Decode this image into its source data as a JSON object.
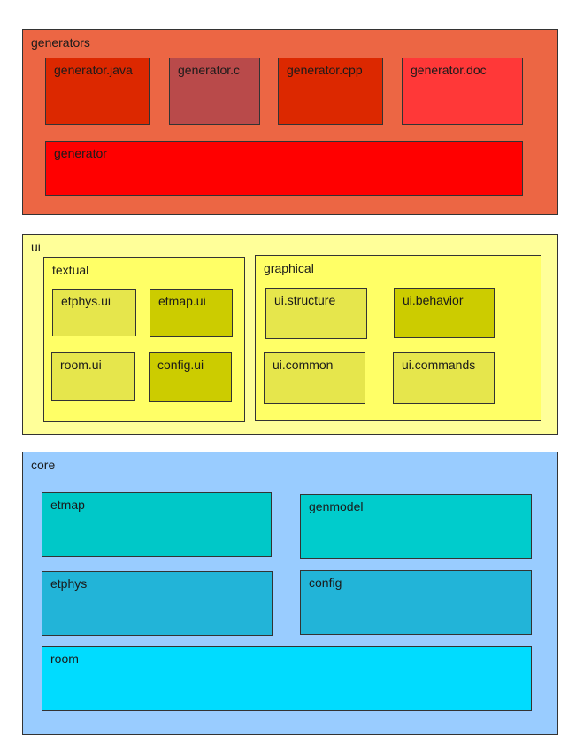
{
  "colors": {
    "generators": "#ec6644",
    "generator_java": "#dc2800",
    "generator_c": "#b94a4a",
    "generator_cpp": "#dc2800",
    "generator_doc": "#ff3838",
    "generator": "#ff0000",
    "ui": "#ffff99",
    "textual": "#ffff66",
    "graphical": "#ffff66",
    "ui_light": "#e6e64c",
    "ui_dark": "#cccc00",
    "core": "#99ccff",
    "etmap": "#00c8c8",
    "genmodel": "#00cccc",
    "etphys": "#22b4d8",
    "config": "#22b4d8",
    "room": "#00dcff",
    "border": "#333333"
  },
  "generators": {
    "label": "generators",
    "items": {
      "java": "generator.java",
      "c": "generator.c",
      "cpp": "generator.cpp",
      "doc": "generator.doc",
      "base": "generator"
    }
  },
  "ui": {
    "label": "ui",
    "textual": {
      "label": "textual",
      "items": {
        "etphys": "etphys.ui",
        "etmap": "etmap.ui",
        "room": "room.ui",
        "config": "config.ui"
      }
    },
    "graphical": {
      "label": "graphical",
      "items": {
        "structure": "ui.structure",
        "behavior": "ui.behavior",
        "common": "ui.common",
        "commands": "ui.commands"
      }
    }
  },
  "core": {
    "label": "core",
    "items": {
      "etmap": "etmap",
      "genmodel": "genmodel",
      "etphys": "etphys",
      "config": "config",
      "room": "room"
    }
  }
}
